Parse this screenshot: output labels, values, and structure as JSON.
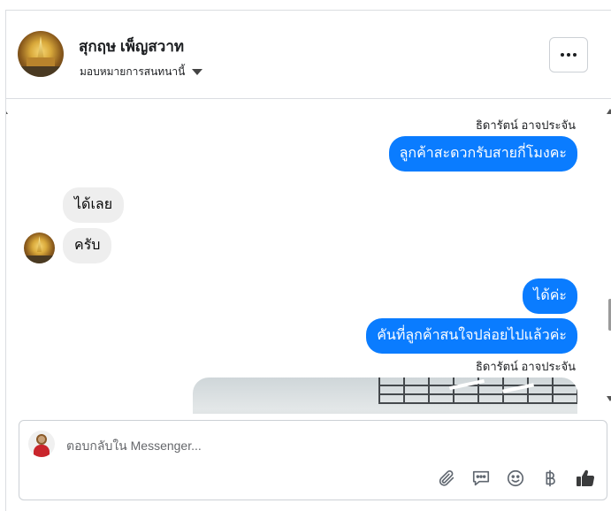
{
  "header": {
    "contact_name": "สุกฤษ เพ็ญสวาท",
    "assign_label": "มอบหมายการสนทนานี้"
  },
  "messages": {
    "sender_label_1": "ธิดารัตน์ อาจประจัน",
    "out_1": "ลูกค้าสะดวกรับสายกี่โมงคะ",
    "in_1": "ได้เลย",
    "in_2": "ครับ",
    "out_2": "ได้ค่ะ",
    "out_3": "คันที่ลูกค้าสนใจปล่อยไปแล้วค่ะ",
    "sender_label_2": "ธิดารัตน์ อาจประจัน"
  },
  "composer": {
    "placeholder": "ตอบกลับใน Messenger..."
  },
  "icons": {
    "more": "more-icon",
    "caret": "caret-down-icon",
    "attach": "paperclip-icon",
    "saved_reply": "saved-reply-icon",
    "emoji": "emoji-icon",
    "payment": "baht-icon",
    "like": "thumbs-up-icon"
  },
  "colors": {
    "outgoing_bubble": "#0a7cff",
    "incoming_bubble": "#eeeeee",
    "border": "#dadde1"
  }
}
